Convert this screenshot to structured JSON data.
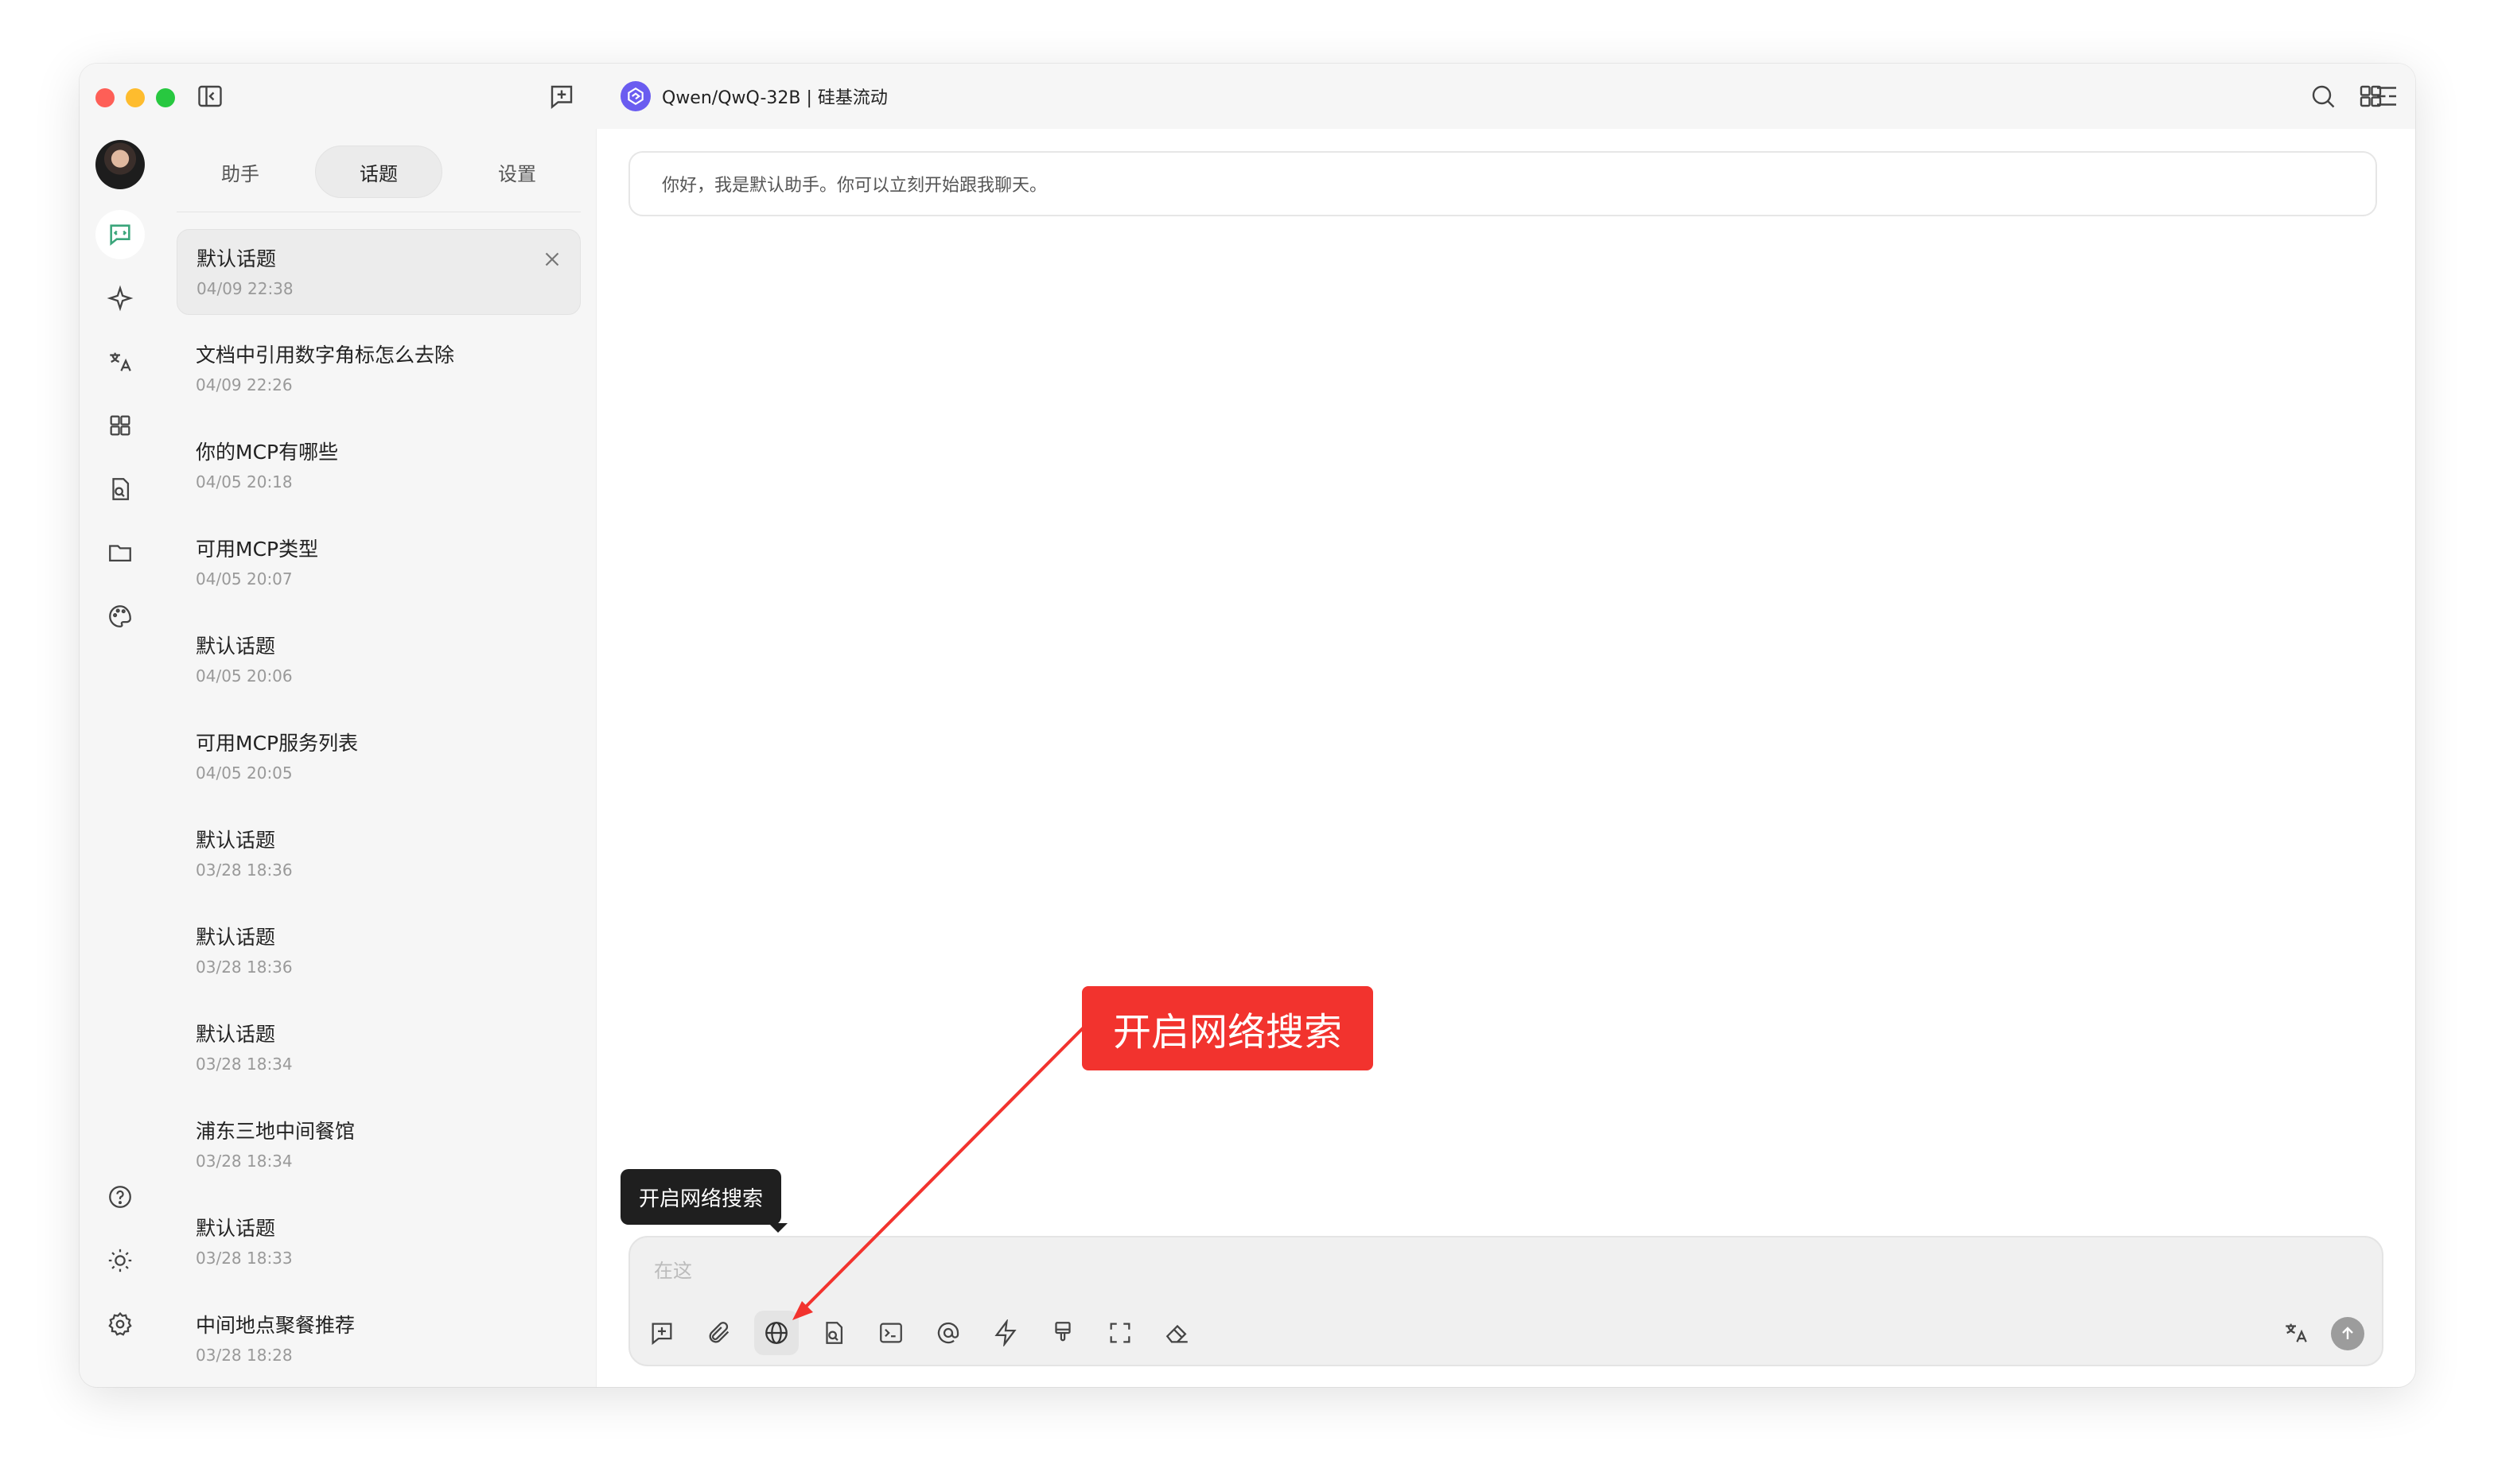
{
  "window": {
    "model_title": "Qwen/QwQ-32B | 硅基流动"
  },
  "titlebar": {
    "left_icons": [
      "sidebar-toggle-icon",
      "new-topic-icon"
    ],
    "right_icons": [
      "search-icon",
      "layout-icon",
      "apps-grid-icon"
    ]
  },
  "rail": {
    "items": [
      "chat-icon",
      "sparkle-icon",
      "translate-icon",
      "apps-icon",
      "file-search-icon",
      "folder-icon",
      "palette-icon"
    ],
    "bottom_items": [
      "help-icon",
      "brightness-icon",
      "settings-icon"
    ]
  },
  "sidebar": {
    "tabs": [
      {
        "label": "助手"
      },
      {
        "label": "话题"
      },
      {
        "label": "设置"
      }
    ],
    "topics": [
      {
        "title": "默认话题",
        "time": "04/09 22:38"
      },
      {
        "title": "文档中引用数字角标怎么去除",
        "time": "04/09 22:26"
      },
      {
        "title": "你的MCP有哪些",
        "time": "04/05 20:18"
      },
      {
        "title": "可用MCP类型",
        "time": "04/05 20:07"
      },
      {
        "title": "默认话题",
        "time": "04/05 20:06"
      },
      {
        "title": "可用MCP服务列表",
        "time": "04/05 20:05"
      },
      {
        "title": "默认话题",
        "time": "03/28 18:36"
      },
      {
        "title": "默认话题",
        "time": "03/28 18:36"
      },
      {
        "title": "默认话题",
        "time": "03/28 18:34"
      },
      {
        "title": "浦东三地中间餐馆",
        "time": "03/28 18:34"
      },
      {
        "title": "默认话题",
        "time": "03/28 18:33"
      },
      {
        "title": "中间地点聚餐推荐",
        "time": "03/28 18:28"
      }
    ]
  },
  "main": {
    "greeting": "你好，我是默认助手。你可以立刻开始跟我聊天。"
  },
  "composer": {
    "placeholder_visible": "在这",
    "tools": [
      "new-topic-icon",
      "attachment-icon",
      "globe-icon",
      "file-search-icon",
      "terminal-icon",
      "at-icon",
      "lightning-icon",
      "brush-icon",
      "fullscreen-icon",
      "eraser-icon"
    ],
    "right_tools": [
      "translate-icon",
      "send-icon"
    ]
  },
  "tooltip": {
    "text": "开启网络搜索"
  },
  "annotation": {
    "callout_text": "开启网络搜索",
    "color": "#f2332e"
  },
  "colors": {
    "accent": "#3aa57a",
    "brand": "#6a5cf0"
  }
}
